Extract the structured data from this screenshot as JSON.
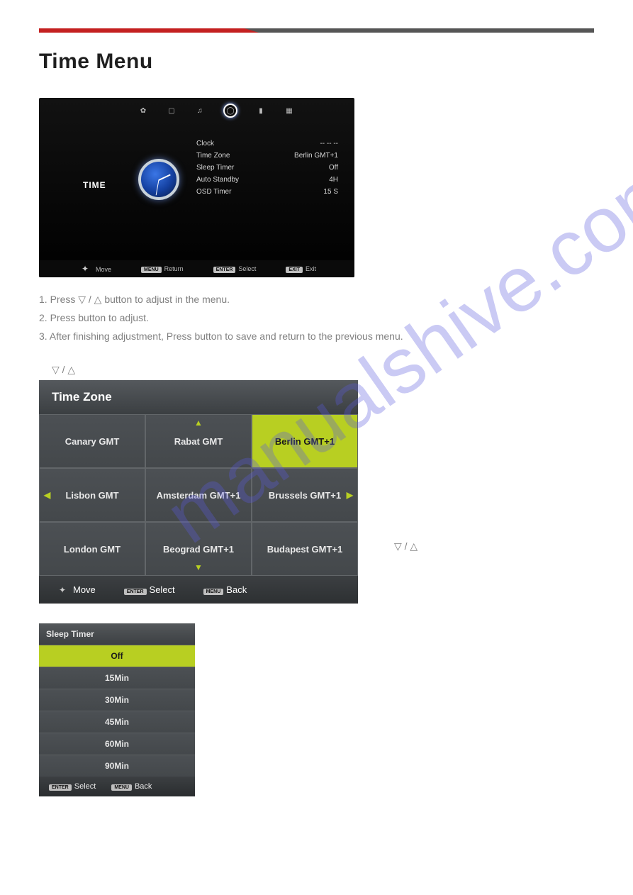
{
  "heading": "Time Menu",
  "watermark": "manualshive.com",
  "tv1": {
    "sideLabel": "TIME",
    "tabs": [
      "gear-icon",
      "monitor-icon",
      "note-icon",
      "clock-icon",
      "lock-icon",
      "grid-icon"
    ],
    "rows": [
      {
        "label": "Clock",
        "value": "-- -- --"
      },
      {
        "label": "Time Zone",
        "value": "Berlin GMT+1"
      },
      {
        "label": "Sleep Timer",
        "value": "Off"
      },
      {
        "label": "Auto Standby",
        "value": "4H"
      },
      {
        "label": "OSD Timer",
        "value": "15 S"
      }
    ],
    "footer": [
      {
        "icon": "move",
        "label": "Move"
      },
      {
        "icon": "MENU",
        "label": "Return"
      },
      {
        "icon": "ENTER",
        "label": "Select"
      },
      {
        "icon": "EXIT",
        "label": "Exit"
      }
    ]
  },
  "instructions": [
    "1. Press ▽ / △ button to  adjust in the            menu.",
    "2. Press              button to adjust.",
    "3. After finishing adjustment, Press              button to save and return to the previous menu."
  ],
  "subArrows": "▽ / △",
  "timezone": {
    "title": "Time Zone",
    "cells": [
      "Canary GMT",
      "Rabat GMT",
      "Berlin GMT+1",
      "Lisbon GMT",
      "Amsterdam GMT+1",
      "Brussels GMT+1",
      "London GMT",
      "Beograd GMT+1",
      "Budapest GMT+1"
    ],
    "selectedIndex": 2,
    "footer": {
      "move": "Move",
      "enter": "ENTER",
      "select": "Select",
      "menu": "MENU",
      "back": "Back"
    }
  },
  "sidenoteArrows": "▽ / △",
  "sleep": {
    "title": "Sleep Timer",
    "options": [
      "Off",
      "15Min",
      "30Min",
      "45Min",
      "60Min",
      "90Min"
    ],
    "selectedIndex": 0,
    "footer": {
      "enter": "ENTER",
      "select": "Select",
      "menu": "MENU",
      "back": "Back"
    }
  }
}
